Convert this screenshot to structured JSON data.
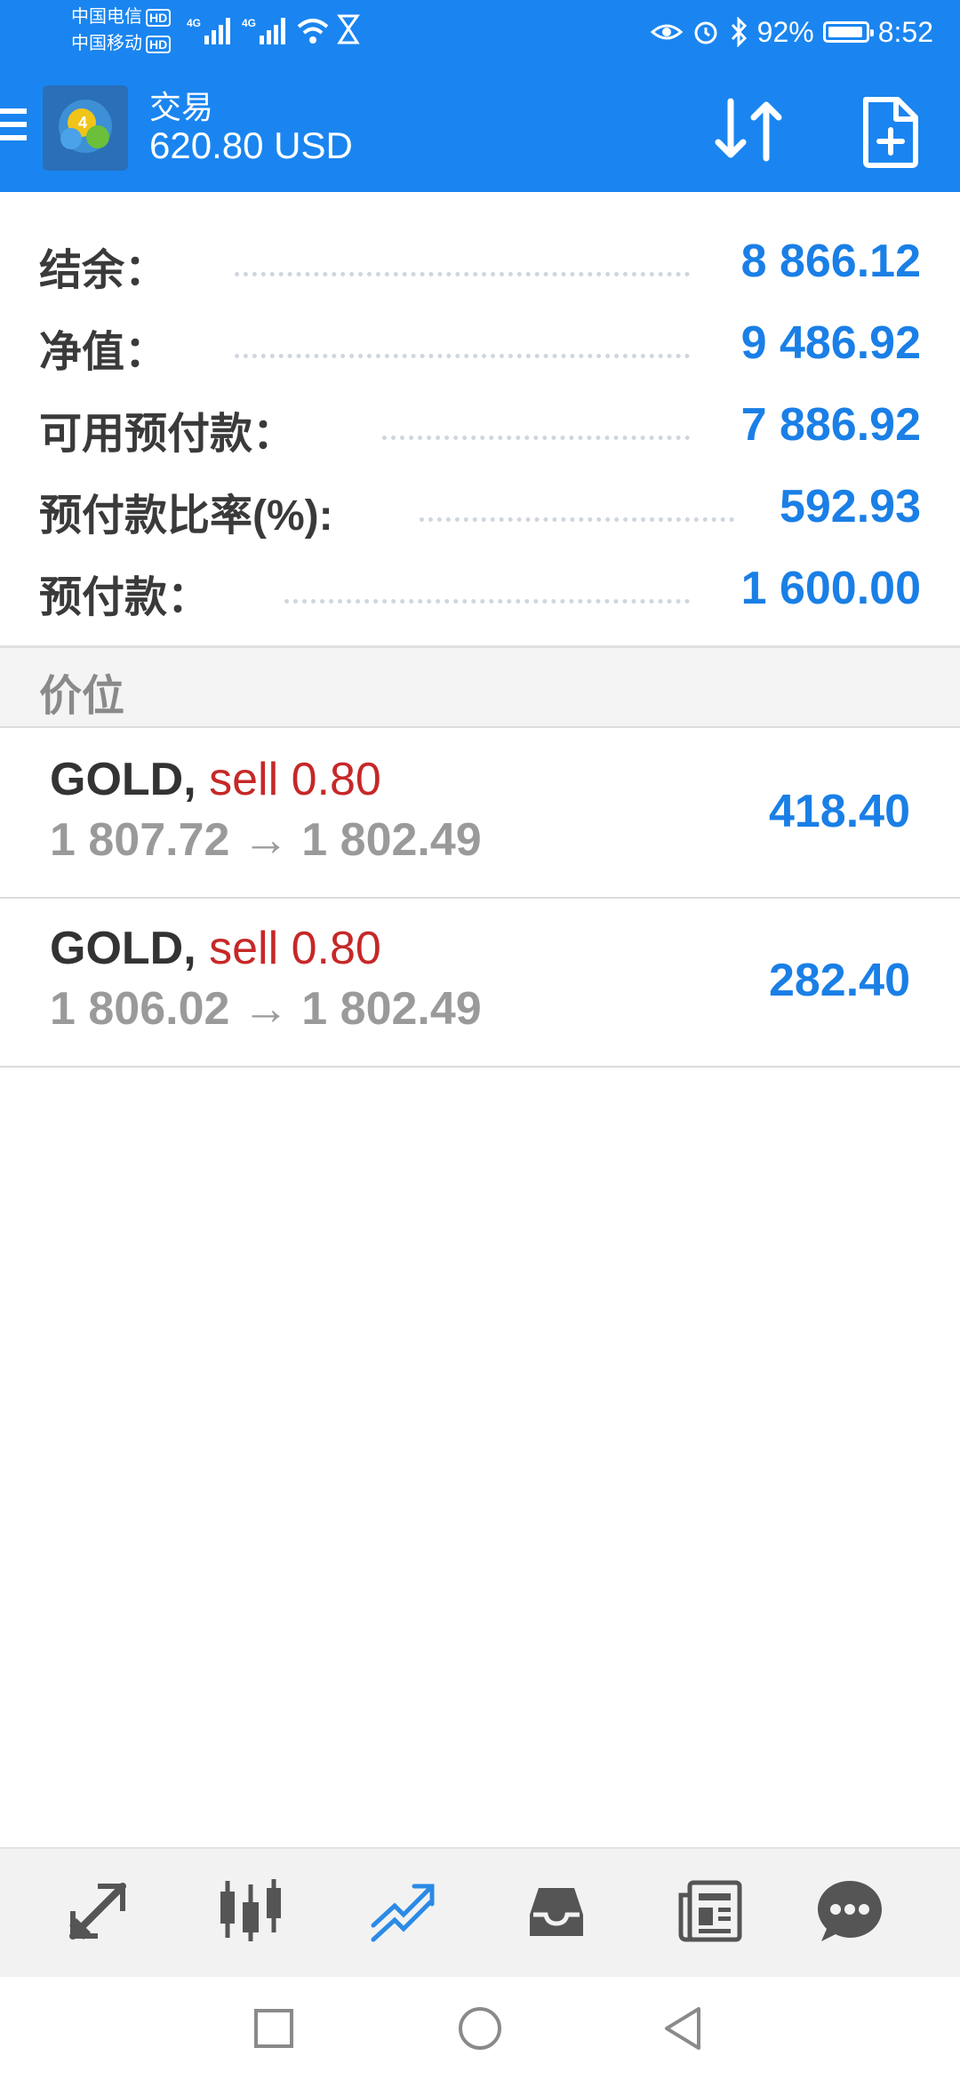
{
  "status_bar": {
    "carrier_1": "中国电信",
    "carrier_2": "中国移动",
    "hd_badge": "HD",
    "network": "4G",
    "battery": "92%",
    "time": "8:52"
  },
  "app_bar": {
    "title": "交易",
    "balance": "620.80 USD"
  },
  "summary": [
    {
      "label": "结余：",
      "value": "8 866.12"
    },
    {
      "label": "净值：",
      "value": "9 486.92"
    },
    {
      "label": "可用预付款：",
      "value": "7 886.92"
    },
    {
      "label": "预付款比率(%):",
      "value": "592.93"
    },
    {
      "label": "预付款：",
      "value": "1 600.00"
    }
  ],
  "section": {
    "title": "价位"
  },
  "positions": [
    {
      "symbol": "GOLD,",
      "side": "sell 0.80",
      "prices": "1 807.72 → 1 802.49",
      "profit": "418.40"
    },
    {
      "symbol": "GOLD,",
      "side": "sell 0.80",
      "prices": "1 806.02 → 1 802.49",
      "profit": "282.40"
    }
  ],
  "colors": {
    "primary": "#1a85f0",
    "value_blue": "#1a7fe6",
    "sell_red": "#c62828"
  },
  "bottom_nav": [
    "quotes-icon",
    "chart-icon",
    "trade-icon",
    "history-icon",
    "news-icon",
    "chat-icon"
  ]
}
